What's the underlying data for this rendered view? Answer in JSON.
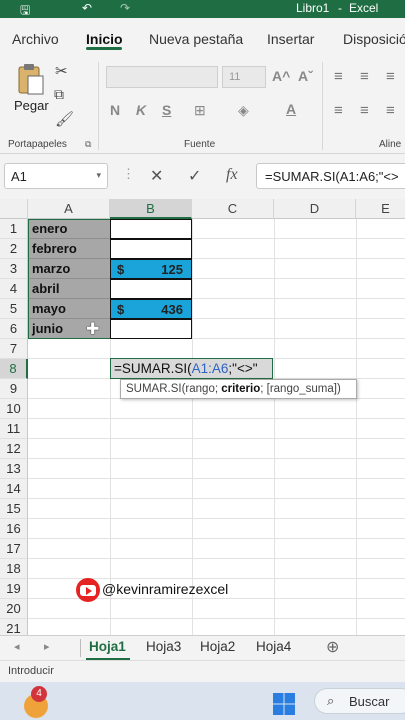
{
  "titlebar": {
    "file": "Libro1",
    "separator": "-",
    "app": "Excel"
  },
  "ribbon_tabs": [
    "Archivo",
    "Inicio",
    "Nueva pestaña",
    "Insertar",
    "Disposició"
  ],
  "ribbon": {
    "paste_label": "Pegar",
    "clipboard_group": "Portapapeles",
    "font_group": "Fuente",
    "align_group": "Aline",
    "font_size": "11",
    "bold": "N",
    "italic": "K",
    "underline": "S",
    "grow_font": "A^",
    "shrink_font": "Aˇ",
    "font_color": "A"
  },
  "formula_bar": {
    "name_box": "A1",
    "fx": "fx",
    "formula": "=SUMAR.SI(A1:A6;\"<>"
  },
  "columns": [
    "A",
    "B",
    "C",
    "D",
    "E"
  ],
  "rows": [
    "1",
    "2",
    "3",
    "4",
    "5",
    "6",
    "7",
    "8",
    "9",
    "10",
    "11",
    "12",
    "13",
    "14",
    "15",
    "16",
    "17",
    "18",
    "19",
    "20",
    "21"
  ],
  "column_a": [
    "enero",
    "febrero",
    "marzo",
    "abril",
    "mayo",
    "junio"
  ],
  "column_b": [
    {
      "cur": "",
      "num": ""
    },
    {
      "cur": "",
      "num": ""
    },
    {
      "cur": "$",
      "num": "125"
    },
    {
      "cur": "",
      "num": ""
    },
    {
      "cur": "$",
      "num": "436"
    },
    {
      "cur": "",
      "num": ""
    }
  ],
  "edit_cell": {
    "prefix": "=SUMAR.SI(",
    "ref": "A1:A6",
    "suffix": ";\"<>\""
  },
  "tooltip": {
    "fn": "SUMAR.SI(",
    "arg1": "rango; ",
    "arg2": "criterio",
    "arg3": "; [rango_suma])"
  },
  "watermark": "@kevinramirezexcel",
  "sheet_tabs": [
    "Hoja1",
    "Hoja3",
    "Hoja2",
    "Hoja4"
  ],
  "status": "Introducir",
  "taskbar": {
    "badge": "4",
    "search": "Buscar"
  },
  "colors": {
    "excel_green": "#1f6e43",
    "highlight_blue": "#1aa4da",
    "selection_gray": "#a7a7a7"
  }
}
